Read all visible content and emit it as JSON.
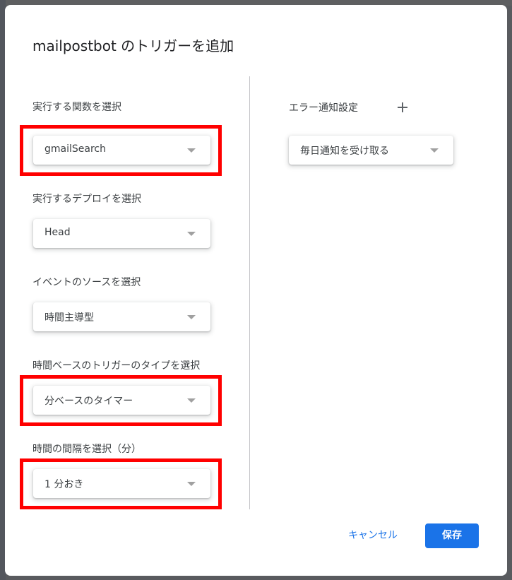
{
  "dialog": {
    "title_app": "mailpostbot",
    "title_rest": " のトリガーを追加"
  },
  "left_column": {
    "fields": [
      {
        "label": "実行する関数を選択",
        "value": "gmailSearch",
        "highlighted": true
      },
      {
        "label": "実行するデプロイを選択",
        "value": "Head",
        "highlighted": false
      },
      {
        "label": "イベントのソースを選択",
        "value": "時間主導型",
        "highlighted": false
      },
      {
        "label": "時間ベースのトリガーのタイプを選択",
        "value": "分ベースのタイマー",
        "highlighted": true
      },
      {
        "label": "時間の間隔を選択（分）",
        "value": "1 分おき",
        "highlighted": true
      }
    ]
  },
  "right_column": {
    "error_notification_label": "エラー通知設定",
    "add_icon": "plus-icon",
    "error_notification_value": "毎日通知を受け取る"
  },
  "footer": {
    "cancel_label": "キャンセル",
    "save_label": "保存"
  },
  "colors": {
    "accent": "#1a73e8",
    "highlight": "#ff0000"
  }
}
